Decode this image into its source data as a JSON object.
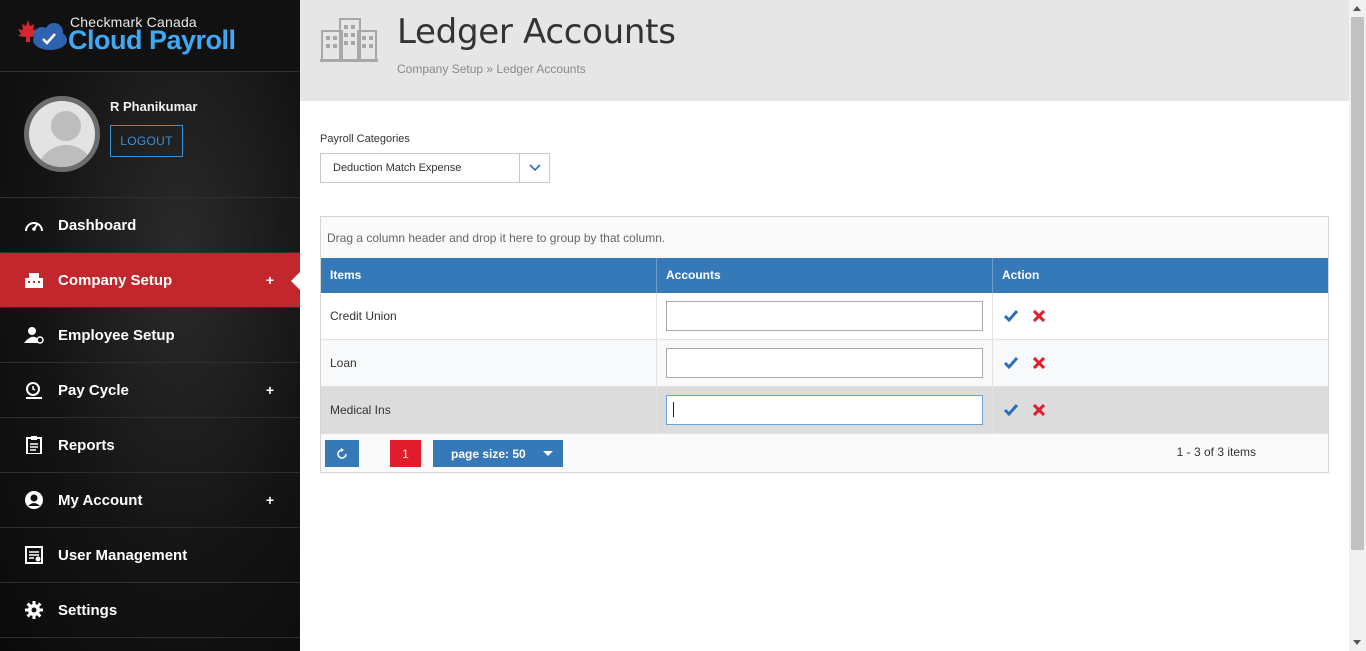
{
  "brand": {
    "top": "Checkmark Canada",
    "main": "Cloud Payroll"
  },
  "user": {
    "name": "R Phanikumar",
    "logout_label": "LOGOUT"
  },
  "nav": [
    {
      "label": "Dashboard",
      "icon": "dashboard-gauge-icon",
      "plus": ""
    },
    {
      "label": "Company Setup",
      "icon": "company-building-icon",
      "plus": "+"
    },
    {
      "label": "Employee Setup",
      "icon": "employee-settings-icon",
      "plus": ""
    },
    {
      "label": "Pay Cycle",
      "icon": "pay-cycle-icon",
      "plus": "+"
    },
    {
      "label": "Reports",
      "icon": "reports-clipboard-icon",
      "plus": ""
    },
    {
      "label": "My Account",
      "icon": "account-user-icon",
      "plus": "+"
    },
    {
      "label": "User Management",
      "icon": "user-management-icon",
      "plus": ""
    },
    {
      "label": "Settings",
      "icon": "settings-gear-icon",
      "plus": ""
    }
  ],
  "header": {
    "title": "Ledger Accounts",
    "breadcrumb": "Company Setup » Ledger Accounts"
  },
  "filter": {
    "label": "Payroll Categories",
    "selected": "Deduction Match Expense"
  },
  "grid": {
    "group_hint": "Drag a column header and drop it here to group by that column.",
    "columns": [
      "Items",
      "Accounts",
      "Action"
    ],
    "rows": [
      {
        "item": "Credit Union",
        "account": ""
      },
      {
        "item": "Loan",
        "account": ""
      },
      {
        "item": "Medical Ins",
        "account": ""
      }
    ],
    "pager": {
      "current_page": "1",
      "page_size": "page size: 50",
      "info": "1 - 3 of 3 items"
    }
  },
  "colors": {
    "sidebar_active": "#c1272d",
    "grid_header": "#3579b8",
    "accent_blue": "#3fa9f5",
    "danger": "#e11d2c"
  }
}
